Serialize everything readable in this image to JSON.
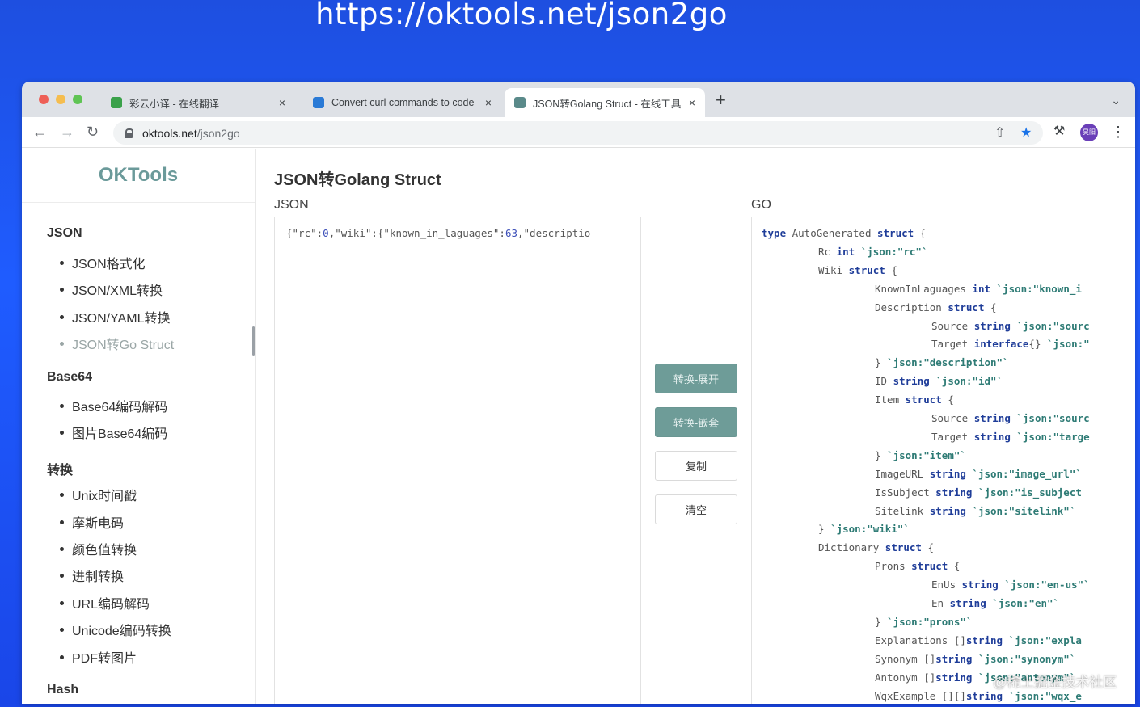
{
  "banner": {
    "url": "https://oktools.net/json2go"
  },
  "browser": {
    "tabs": [
      {
        "title": "彩云小译 - 在线翻译",
        "favicon_color": "#3aa14a",
        "active": false
      },
      {
        "title": "Convert curl commands to code",
        "favicon_color": "#2a7ad6",
        "active": false
      },
      {
        "title": "JSON转Golang Struct - 在线工具",
        "favicon_color": "#5a8a8a",
        "active": true
      }
    ],
    "new_tab_label": "+",
    "close_label": "×",
    "address": {
      "host": "oktools.net",
      "path": "/json2go"
    },
    "avatar_label": "昊阳",
    "icons": {
      "back": "back-arrow-icon",
      "forward": "forward-arrow-icon",
      "reload": "reload-icon",
      "share": "share-icon",
      "bookmark": "star-icon",
      "extensions": "puzzle-icon",
      "menu": "kebab-menu-icon"
    }
  },
  "sidebar": {
    "logo": "OKTools",
    "groups": [
      {
        "title": "JSON",
        "items": [
          "JSON格式化",
          "JSON/XML转换",
          "JSON/YAML转换",
          "JSON转Go Struct"
        ],
        "active_index": 3
      },
      {
        "title": "Base64",
        "items": [
          "Base64编码解码",
          "图片Base64编码"
        ]
      },
      {
        "title": "转换",
        "items": [
          "Unix时间戳",
          "摩斯电码",
          "颜色值转换",
          "进制转换",
          "URL编码解码",
          "Unicode编码转换",
          "PDF转图片"
        ]
      },
      {
        "title": "Hash",
        "items": []
      }
    ]
  },
  "main": {
    "title": "JSON转Golang Struct",
    "json_label": "JSON",
    "go_label": "GO",
    "json_input": "{\"rc\":0,\"wiki\":{\"known_in_laguages\":63,\"descriptio",
    "buttons": {
      "expand": "转换-展开",
      "nested": "转换-嵌套",
      "copy": "复制",
      "clear": "清空"
    },
    "go_output": [
      "type AutoGenerated struct {",
      "Rc int `json:\"rc\"`",
      "Wiki struct {",
      "KnownInLaguages int `json:\"known_i",
      "Description struct {",
      "Source string `json:\"sourc",
      "Target interface{} `json:\"",
      "} `json:\"description\"`",
      "ID string `json:\"id\"`",
      "Item struct {",
      "Source string `json:\"sourc",
      "Target string `json:\"targe",
      "} `json:\"item\"`",
      "ImageURL string `json:\"image_url\"`",
      "IsSubject string `json:\"is_subject",
      "Sitelink string `json:\"sitelink\"`",
      "} `json:\"wiki\"`",
      "Dictionary struct {",
      "Prons struct {",
      "EnUs string `json:\"en-us\"`",
      "En string `json:\"en\"`",
      "} `json:\"prons\"`",
      "Explanations []string `json:\"expla",
      "Synonym []string `json:\"synonym\"`",
      "Antonym []string `json:\"antonym\"`",
      "WqxExample [][]string `json:\"wqx_e"
    ]
  },
  "watermark": "@稀土掘金技术社区"
}
